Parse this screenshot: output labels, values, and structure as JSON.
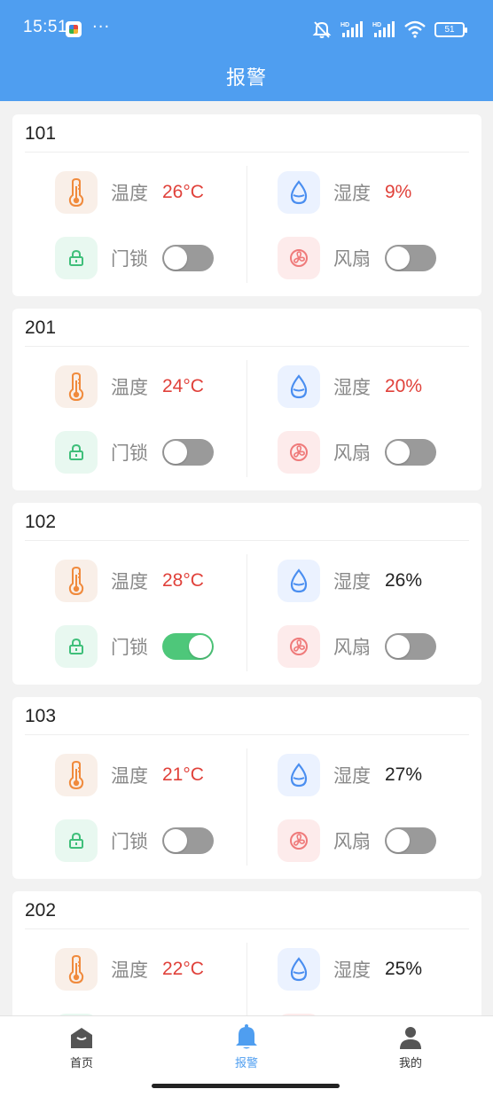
{
  "status_bar": {
    "time": "15:51",
    "dots": "···",
    "battery": "51",
    "icons": [
      "mute-icon",
      "hd-signal-icon",
      "hd-signal-icon",
      "wifi-icon",
      "battery-icon"
    ]
  },
  "header": {
    "title": "报警"
  },
  "colors": {
    "accent": "#4f9ef0",
    "alarm": "#e0413a",
    "toggle_on": "#4ec77a",
    "toggle_off": "#9a9a9a"
  },
  "labels": {
    "temp": "温度",
    "humidity": "湿度",
    "lock": "门锁",
    "fan": "风扇"
  },
  "rooms": [
    {
      "name": "101",
      "temperature": "26°C",
      "temp_alarm": true,
      "humidity": "9%",
      "humi_alarm": true,
      "lock_on": false,
      "fan_on": false
    },
    {
      "name": "201",
      "temperature": "24°C",
      "temp_alarm": true,
      "humidity": "20%",
      "humi_alarm": true,
      "lock_on": false,
      "fan_on": false
    },
    {
      "name": "102",
      "temperature": "28°C",
      "temp_alarm": true,
      "humidity": "26%",
      "humi_alarm": false,
      "lock_on": true,
      "fan_on": false
    },
    {
      "name": "103",
      "temperature": "21°C",
      "temp_alarm": true,
      "humidity": "27%",
      "humi_alarm": false,
      "lock_on": false,
      "fan_on": false
    },
    {
      "name": "202",
      "temperature": "22°C",
      "temp_alarm": true,
      "humidity": "25%",
      "humi_alarm": false,
      "lock_on": false,
      "fan_on": false
    }
  ],
  "tabs": [
    {
      "label": "首页",
      "icon": "home-icon",
      "active": false
    },
    {
      "label": "报警",
      "icon": "bell-icon",
      "active": true
    },
    {
      "label": "我的",
      "icon": "person-icon",
      "active": false
    }
  ]
}
